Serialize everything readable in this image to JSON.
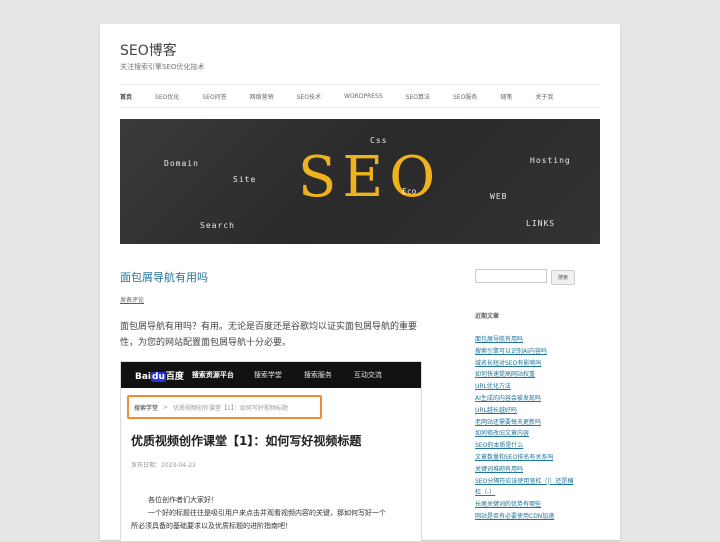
{
  "site": {
    "title": "SEO博客",
    "description": "关注搜索引擎SEO优化技术"
  },
  "nav": [
    {
      "label": "首页",
      "current": true
    },
    {
      "label": "SEO优化"
    },
    {
      "label": "SEO问答"
    },
    {
      "label": "网络营销"
    },
    {
      "label": "SEO技术"
    },
    {
      "label": "WORDPRESS"
    },
    {
      "label": "SEO算法"
    },
    {
      "label": "SEO服务"
    },
    {
      "label": "随笔"
    },
    {
      "label": "关于我"
    }
  ],
  "banner": {
    "main": "SEO",
    "words": [
      "Css",
      "Domain",
      "Site",
      "Eco",
      "Hosting",
      "WEB",
      "Search",
      "LINKS"
    ]
  },
  "post": {
    "title": "面包屑导航有用吗",
    "comment_link": "发表评论",
    "paragraph": "面包屑导航有用吗？有用。无论是百度还是谷歌均以证实面包屑导航的重要性，为您的网站配置面包屑导航十分必要。"
  },
  "screenshot": {
    "logo_a": "Bai",
    "logo_b": "du",
    "logo_c": "百度",
    "platform": "搜索资源平台",
    "tabs": [
      "搜索学堂",
      "搜索服务",
      "互动交流"
    ],
    "breadcrumb_root": "搜索学堂",
    "breadcrumb_sep": ">",
    "breadcrumb_current": "优质视频创作课堂【1】：如何写好视频标题",
    "heading": "优质视频创作课堂【1】：如何写好视频标题",
    "date": "发布日期：2023-04-23",
    "lines": [
      "各位创作者们大家好！",
      "一个好的标题往往是吸引用户来点击并观看视频内容的关键，那如何写好一个",
      "所必须具备的基础要求以及优质标题的进阶指南吧！"
    ]
  },
  "sidebar": {
    "search_placeholder": "",
    "search_button": "搜索",
    "recent_title": "近期文章",
    "recent_posts": [
      "面包屑导航有用吗",
      "搜索引擎可以识别AI内容吗",
      "域名长短对SEO有影响吗",
      "如何快速提高网站权重",
      "URL优化方法",
      "AI生成的内容会被发现吗",
      "URL越长越好吗",
      "老网站还需要每天更新吗",
      "如何修改旧文章内容",
      "SEO的本质是什么",
      "文章数量和SEO排名有关系吗",
      "关键词堆砌有用吗",
      "SEO分隔符应该使用竖杠（|）还是横杠（-）",
      "长尾关键词的优势有哪些",
      "网站是否有必要使用CDN加速"
    ]
  }
}
